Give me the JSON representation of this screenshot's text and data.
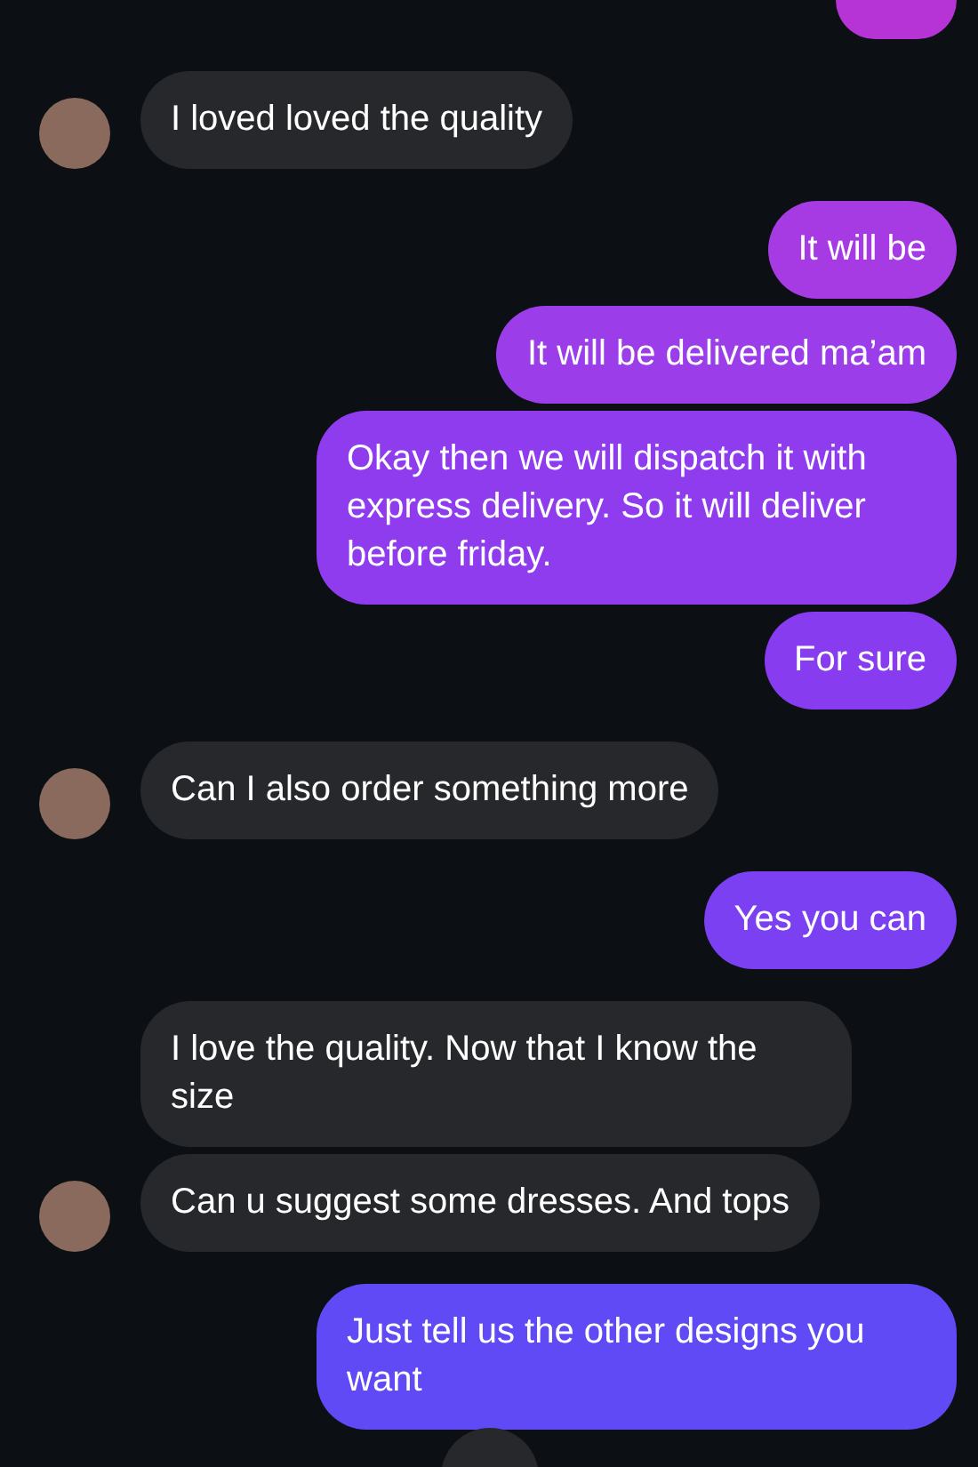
{
  "messages": [
    {
      "outgoing": true,
      "kind": "cut",
      "color": "#b634d6"
    },
    {
      "outgoing": false,
      "kind": "text",
      "text": "I loved loved the quality",
      "avatar": true
    },
    {
      "outgoing": true,
      "kind": "text",
      "text": "It will be",
      "color": "#a63be3"
    },
    {
      "outgoing": true,
      "kind": "text",
      "text": "It will be delivered ma’am",
      "color": "#9b3de8"
    },
    {
      "outgoing": true,
      "kind": "text",
      "text": "Okay then we will dispatch it with express delivery. So it will deliver before friday.",
      "color": "#8e3ced"
    },
    {
      "outgoing": true,
      "kind": "text",
      "text": "For sure",
      "color": "#873cf0"
    },
    {
      "outgoing": false,
      "kind": "text",
      "text": "Can I also order something more",
      "avatar": true
    },
    {
      "outgoing": true,
      "kind": "text",
      "text": "Yes you can",
      "color": "#7a40f1"
    },
    {
      "outgoing": false,
      "kind": "text",
      "text": "I love the quality. Now that I know the size",
      "avatar": false
    },
    {
      "outgoing": false,
      "kind": "text",
      "text": "Can u suggest some dresses. And tops",
      "avatar": true
    },
    {
      "outgoing": true,
      "kind": "text",
      "text": "Just tell us the other designs you want",
      "color": "#5f4af5"
    }
  ]
}
